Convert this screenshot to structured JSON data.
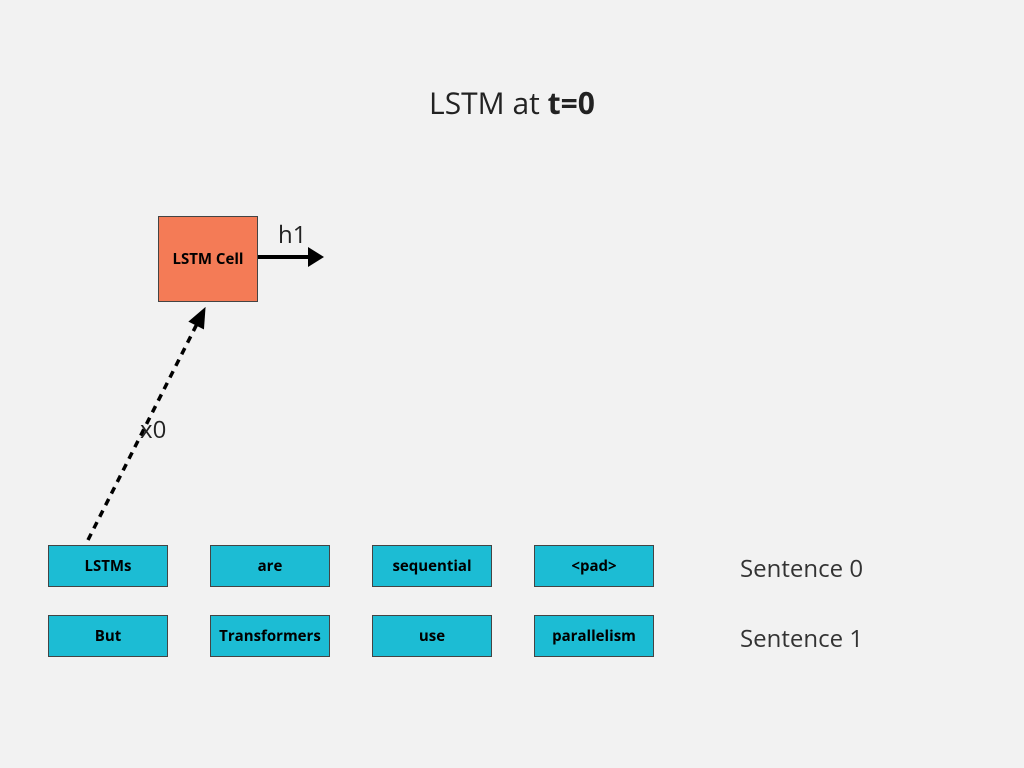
{
  "title_prefix": "LSTM at ",
  "title_bold": "t=0",
  "lstm_cell_label": "LSTM Cell",
  "h1_label": "h1",
  "x0_label": "x0",
  "sentences": [
    {
      "label": "Sentence 0",
      "tokens": [
        "LSTMs",
        "are",
        "sequential",
        "<pad>"
      ]
    },
    {
      "label": "Sentence 1",
      "tokens": [
        "But",
        "Transformers",
        "use",
        "parallelism"
      ]
    }
  ]
}
